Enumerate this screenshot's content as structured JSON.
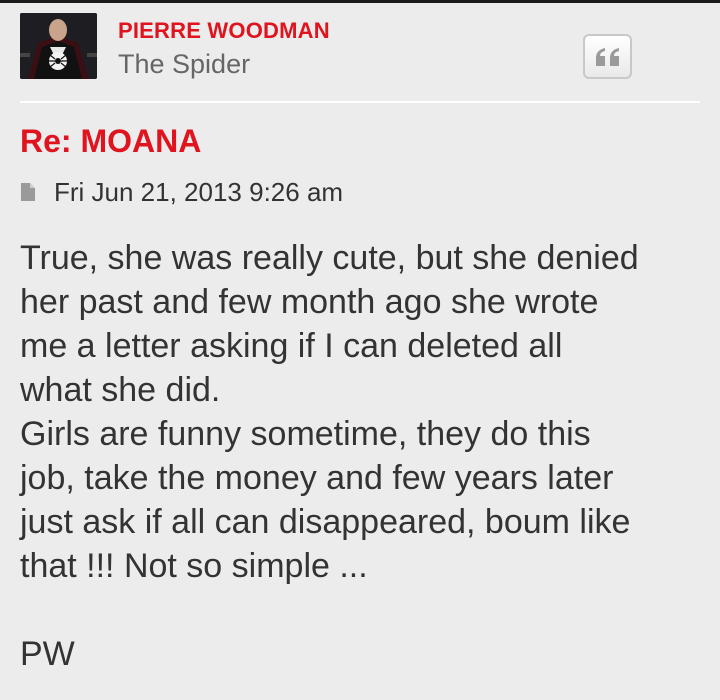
{
  "author": {
    "name": "PIERRE WOODMAN",
    "rank": "The Spider",
    "avatar_icon": "spider-emblem-avatar"
  },
  "actions": {
    "quote_icon": "quote-icon"
  },
  "post": {
    "title": "Re: MOANA",
    "post_icon": "post-icon",
    "date": "Fri Jun 21, 2013 9:26 am",
    "content_lines": [
      "True, she was really cute, but she denied",
      "her past and few month ago she wrote",
      "me a letter asking if I can deleted all",
      "what she did.",
      "Girls are funny sometime, they do this",
      "job, take the money and few years later",
      "just ask if all can disappeared, boum like",
      "that !!! Not so simple ..."
    ],
    "signature": "PW"
  },
  "colors": {
    "accent": "#e0141e",
    "background": "#ececec",
    "text": "#333333",
    "muted": "#666666"
  }
}
